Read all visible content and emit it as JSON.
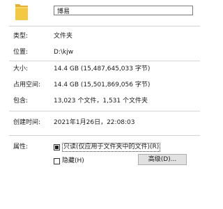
{
  "header": {
    "icon": "folder-icon",
    "folder_color": "#f3c843",
    "name_value": "博易"
  },
  "info": {
    "type_label": "类型:",
    "type_value": "文件夹",
    "location_label": "位置:",
    "location_value": "D:\\kjw",
    "size_label": "大小:",
    "size_value": "14.4 GB (15,487,645,033 字节)",
    "size_on_disk_label": "占用空间:",
    "size_on_disk_value": "14.4 GB (15,501,869,056 字节)",
    "contains_label": "包含:",
    "contains_value": "13,023 个文件，1,531 个文件夹",
    "created_label": "创建时间:",
    "created_value": "2021年1月26日，22:08:03"
  },
  "attributes": {
    "label": "属性:",
    "readonly_label": "只读(仅应用于文件夹中的文件)(R)",
    "readonly_state": "indeterminate",
    "hidden_label": "隐藏(H)",
    "hidden_state": "unchecked",
    "advanced_button_label": "高级(D)..."
  }
}
